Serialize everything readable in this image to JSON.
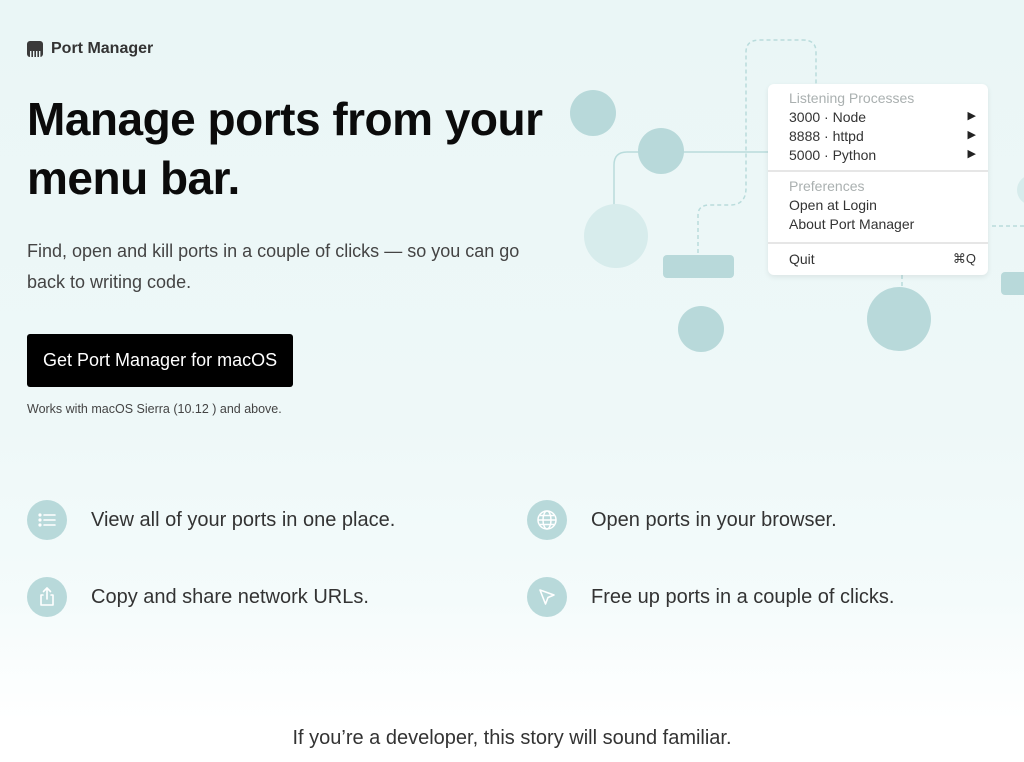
{
  "brand": {
    "name": "Port Manager"
  },
  "hero": {
    "title": "Manage ports from your menu bar.",
    "subtitle": "Find, open and kill ports in a couple of clicks — so you can go back to writing code.",
    "cta_label": "Get Port Manager for macOS",
    "compat_note": "Works with macOS Sierra (10.12 ) and above."
  },
  "menu": {
    "listening_header": "Listening Processes",
    "processes": [
      {
        "label": "3000 · Node",
        "arrow": "▶"
      },
      {
        "label": "8888 · httpd",
        "arrow": "▶"
      },
      {
        "label": "5000 · Python",
        "arrow": "▶"
      }
    ],
    "preferences_header": "Preferences",
    "open_at_login": "Open at Login",
    "about": "About Port Manager",
    "quit": "Quit",
    "quit_shortcut": "⌘Q"
  },
  "features": [
    {
      "icon": "list-icon",
      "text": "View all of your ports in one place."
    },
    {
      "icon": "globe-icon",
      "text": "Open ports in your browser."
    },
    {
      "icon": "share-icon",
      "text": "Copy and share network URLs."
    },
    {
      "icon": "cursor-icon",
      "text": "Free up ports in a couple of clicks."
    }
  ],
  "story": {
    "heading": "If you’re a developer, this story will sound familiar."
  },
  "colors": {
    "accent_circle": "#b8d9da",
    "light_circle": "#d7ecec",
    "background": "#eaf6f6",
    "cta": "#000000"
  }
}
